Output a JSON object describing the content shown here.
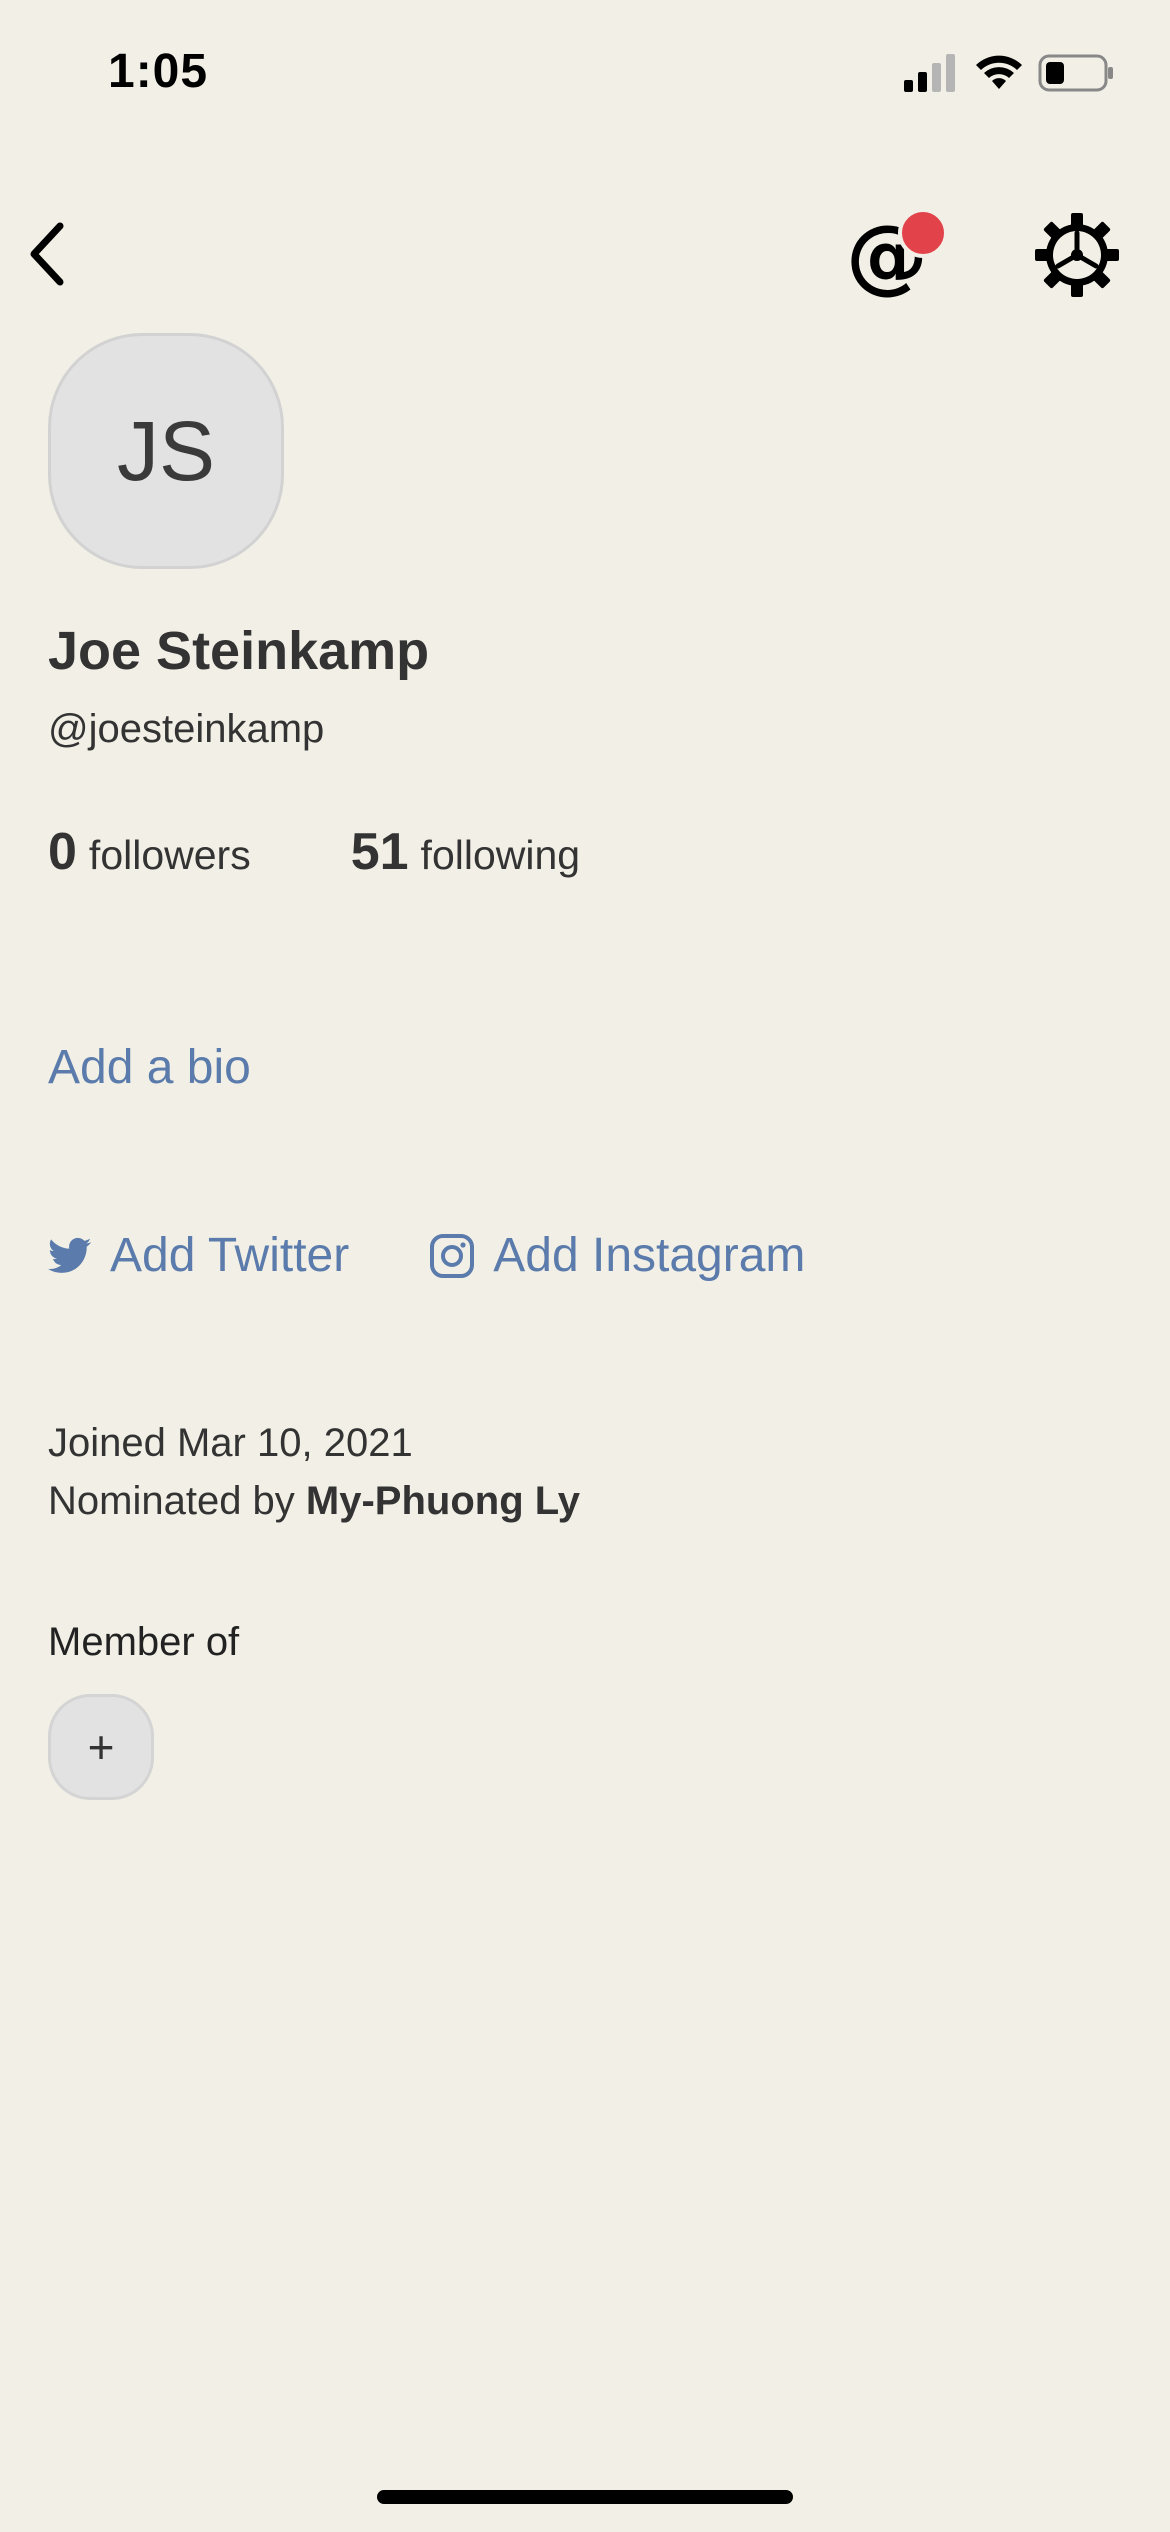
{
  "status_bar": {
    "time": "1:05"
  },
  "nav": {
    "mention_symbol": "@"
  },
  "profile": {
    "initials": "JS",
    "name": "Joe Steinkamp",
    "handle": "@joesteinkamp",
    "followers_count": "0",
    "followers_label": "followers",
    "following_count": "51",
    "following_label": "following"
  },
  "bio": {
    "add_label": "Add a bio"
  },
  "social": {
    "twitter_label": "Add Twitter",
    "instagram_label": "Add Instagram"
  },
  "details": {
    "joined": "Joined Mar 10, 2021",
    "nominated_prefix": "Nominated by ",
    "nominated_by": "My-Phuong Ly"
  },
  "clubs": {
    "heading": "Member of",
    "add_symbol": "+"
  },
  "icons": {
    "back": "chevron-left-icon",
    "mentions": "at-icon",
    "settings": "gear-icon",
    "twitter": "twitter-icon",
    "instagram": "instagram-icon"
  },
  "colors": {
    "background": "#f2f0e6",
    "link": "#5a7bab",
    "notification": "#e2434b",
    "text": "#333333"
  }
}
